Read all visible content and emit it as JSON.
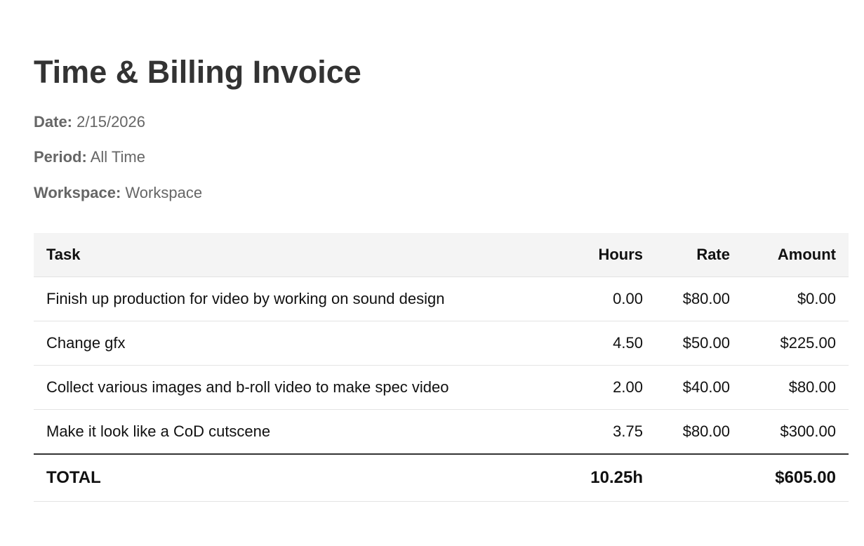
{
  "invoice": {
    "title": "Time & Billing Invoice",
    "meta": {
      "date_label": "Date:",
      "date_value": "2/15/2026",
      "period_label": "Period:",
      "period_value": "All Time",
      "workspace_label": "Workspace:",
      "workspace_value": "Workspace"
    },
    "columns": {
      "task": "Task",
      "hours": "Hours",
      "rate": "Rate",
      "amount": "Amount"
    },
    "rows": [
      {
        "task": "Finish up production for video by working on sound design",
        "hours": "0.00",
        "rate": "$80.00",
        "amount": "$0.00"
      },
      {
        "task": "Change gfx",
        "hours": "4.50",
        "rate": "$50.00",
        "amount": "$225.00"
      },
      {
        "task": "Collect various images and b-roll video to make spec video",
        "hours": "2.00",
        "rate": "$40.00",
        "amount": "$80.00"
      },
      {
        "task": "Make it look like a CoD cutscene",
        "hours": "3.75",
        "rate": "$80.00",
        "amount": "$300.00"
      }
    ],
    "total": {
      "label": "TOTAL",
      "hours": "10.25h",
      "rate": "",
      "amount": "$605.00"
    }
  }
}
